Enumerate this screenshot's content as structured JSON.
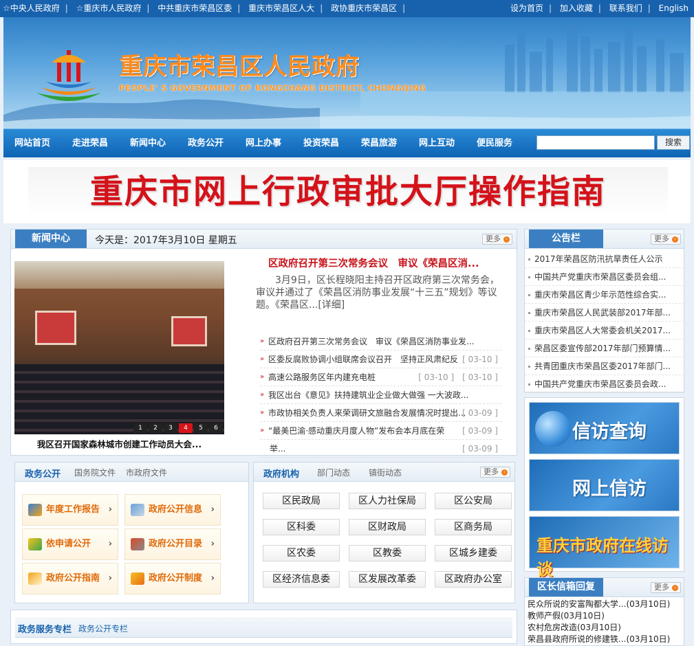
{
  "topbar": {
    "left_links": [
      "☆中央人民政府",
      "☆重庆市人民政府",
      "中共重庆市荣昌区委",
      "重庆市荣昌区人大",
      "政协重庆市荣昌区"
    ],
    "right_links": [
      "设为首页",
      "加入收藏",
      "联系我们",
      "English"
    ]
  },
  "banner": {
    "title": "重庆市荣昌区人民政府",
    "subtitle": "PEOPLE' S GOVERNMENT OF RONGCHANG DISTRICT, CHONGQING"
  },
  "nav": {
    "items": [
      "网站首页",
      "走进荣昌",
      "新闻中心",
      "政务公开",
      "网上办事",
      "投资荣昌",
      "荣昌旅游",
      "网上互动",
      "便民服务"
    ],
    "search_button": "搜索"
  },
  "ad": {
    "text": "重庆市网上行政审批大厅操作指南"
  },
  "news": {
    "tab": "新闻中心",
    "date": "今天是：2017年3月10日 星期五",
    "more": "更多",
    "photo_caption": "我区召开国家森林城市创建工作动员大会...",
    "pager": [
      "1",
      "2",
      "3",
      "4",
      "5",
      "6"
    ],
    "headline": "区政府召开第三次常务会议　审议《荣昌区消...",
    "summary": "3月9日，区长程晓阳主持召开区政府第三次常务会，审议并通过了《荣昌区消防事业发展“十三五”规划》等议题。《荣昌区...[详细]",
    "list": [
      {
        "title": "区政府召开第三次常务会议　审议《荣昌区消防事业发...",
        "date": ""
      },
      {
        "title": "区委反腐败协调小组联席会议召开　坚持正风肃纪反",
        "date": "[ 03-10 ]"
      },
      {
        "title": "高速公路服务区年内建充电桩",
        "date": "[ 03-10 ]　[ 03-10 ]"
      },
      {
        "title": "我区出台《意见》扶持建筑业企业做大做强 一大波政...",
        "date": ""
      },
      {
        "title": "市政协相关负责人来荣调研文旅融合发展情况时提出...",
        "date": "[ 03-09 ]"
      },
      {
        "title": "“最美巴渝·感动重庆月度人物”发布会本月底在荣",
        "date": "[ 03-09 ]"
      },
      {
        "title": "举...",
        "date": "[ 03-09 ]"
      }
    ]
  },
  "gov_open": {
    "tabs": [
      "政务公开",
      "国务院文件",
      "市政府文件"
    ],
    "items": [
      "年度工作报告",
      "政府公开信息",
      "依申请公开",
      "政府公开目录",
      "政府公开指南",
      "政府公开制度"
    ]
  },
  "gov_org": {
    "tabs": [
      "政府机构",
      "部门动态",
      "镇街动态"
    ],
    "more": "更多",
    "items": [
      "区民政局",
      "区人力社保局",
      "区公安局",
      "区科委",
      "区财政局",
      "区商务局",
      "区农委",
      "区教委",
      "区城乡建委",
      "区经济信息委",
      "区发展改革委",
      "区政府办公室"
    ]
  },
  "notice": {
    "tab": "公告栏",
    "more": "更多",
    "items": [
      "2017年荣昌区防汛抗旱责任人公示",
      "中国共产党重庆市荣昌区委员会组...",
      "重庆市荣昌区青少年示范性综合实...",
      "重庆市荣昌区人民武装部2017年部...",
      "重庆市荣昌区人大常委会机关2017...",
      "荣昌区委宣传部2017年部门预算情...",
      "共青团重庆市荣昌区委2017年部门...",
      "中国共产党重庆市荣昌区委员会政..."
    ]
  },
  "quick_links": [
    "信访查询",
    "网上信访",
    "重庆市政府在线访谈"
  ],
  "mailbox": {
    "tab": "区长信箱回复",
    "more": "更多",
    "items": [
      "民众所说的安富陶都大学...(03月10日)",
      "教师产假(03月10日)",
      "农村危房改造(03月10日)",
      "荣昌县政府所说的修建铁...(03月10日)"
    ]
  },
  "service": {
    "tabs": [
      "政务服务专栏",
      "政务公开专栏"
    ]
  },
  "colors": {
    "brand_blue": "#1862ad",
    "headline_red": "#c8121a",
    "accent_orange": "#ff8a1c"
  }
}
